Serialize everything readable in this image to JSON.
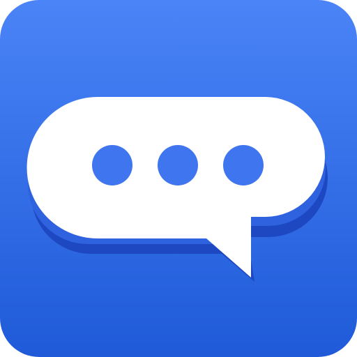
{
  "app_icon": {
    "icon_name": "chat-bubble-icon",
    "colors": {
      "background_top": "#4A84F7",
      "background_bottom": "#1F5AD8",
      "bubble_shadow_dark": "#1E47C2",
      "bubble_shadow_light": "#2F62DF",
      "bubble_fill": "#FFFFFF",
      "dot_fill": "#3F75EE"
    },
    "dot_count": 3
  }
}
